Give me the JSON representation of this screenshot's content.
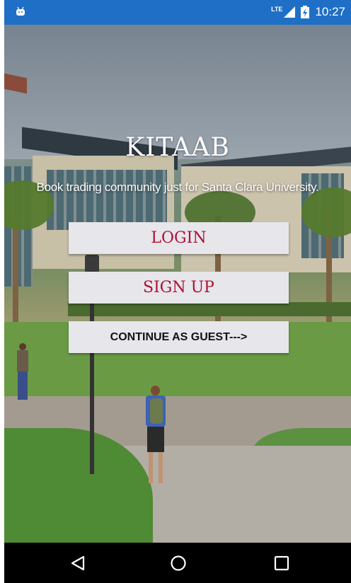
{
  "status_bar": {
    "network": "LTE",
    "time": "10:27"
  },
  "brand": "KITAAB",
  "tagline": "Book trading community just for Santa Clara University.",
  "buttons": {
    "login": "LOGIN",
    "signup": "SIGN UP",
    "guest": "CONTINUE AS GUEST--->"
  },
  "colors": {
    "status_bar": "#1e6fc5",
    "button_bg": "#e6e6eb",
    "accent_text": "#b01032"
  },
  "nav": [
    "back-icon",
    "home-icon",
    "recents-icon"
  ]
}
